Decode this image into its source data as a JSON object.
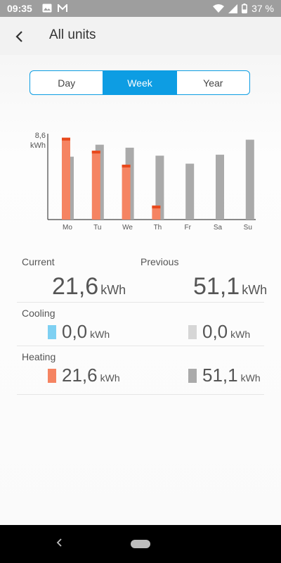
{
  "status": {
    "time": "09:35",
    "battery": "37 %"
  },
  "header": {
    "title": "All units"
  },
  "period_tabs": [
    {
      "label": "Day",
      "active": false
    },
    {
      "label": "Week",
      "active": true
    },
    {
      "label": "Year",
      "active": false
    }
  ],
  "chart_data": {
    "type": "bar",
    "categories": [
      "Mo",
      "Tu",
      "We",
      "Th",
      "Fr",
      "Sa",
      "Su"
    ],
    "max_label": "8,6",
    "unit_label": "kWh",
    "ylim": [
      0,
      8.6
    ],
    "series": [
      {
        "values": [
          8.2,
          6.9,
          5.5,
          1.4,
          null,
          null,
          null
        ],
        "color": "#f58462",
        "cap_color": "#e8491c"
      },
      {
        "values": [
          6.3,
          7.5,
          7.2,
          6.4,
          5.6,
          6.5,
          8.0
        ],
        "color": "#aaaaaa"
      }
    ]
  },
  "summary": {
    "current_label": "Current",
    "previous_label": "Previous",
    "current_total": "21,6",
    "previous_total": "51,1",
    "unit": "kWh",
    "cooling_label": "Cooling",
    "cooling_current": "0,0",
    "cooling_previous": "0,0",
    "heating_label": "Heating",
    "heating_current": "21,6",
    "heating_previous": "51,1",
    "colors": {
      "cooling_current": "#7ed0f2",
      "cooling_previous": "#d6d6d6",
      "heating_current": "#f58462",
      "heating_previous": "#aaaaaa"
    }
  }
}
